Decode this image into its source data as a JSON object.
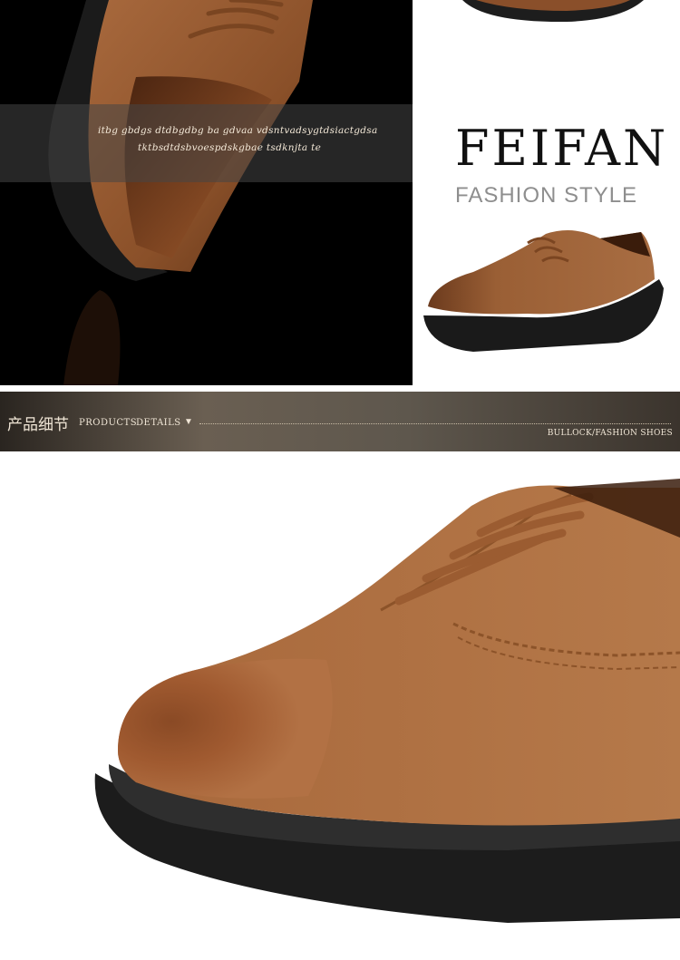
{
  "hero": {
    "caption_line_1": "itbg gbdgs dtdbgdbg ba gdvaa vdsntvadsygtdsiactgdsa",
    "caption_line_2": "tktbsdtdsbvoespdskgbae tsdknjta te"
  },
  "brand": {
    "name": "FEIFAN",
    "tagline": "FASHION STYLE"
  },
  "section": {
    "title_cn": "产品细节",
    "title_en_1": "PRODUCTS",
    "title_en_2": "DETAILS",
    "arrow": "▼",
    "tag": "BULLOCK/FASHION SHOES"
  },
  "colors": {
    "suede": "#a9683b",
    "suede_dark": "#6e3a1c",
    "sole": "#1a1a1a"
  }
}
